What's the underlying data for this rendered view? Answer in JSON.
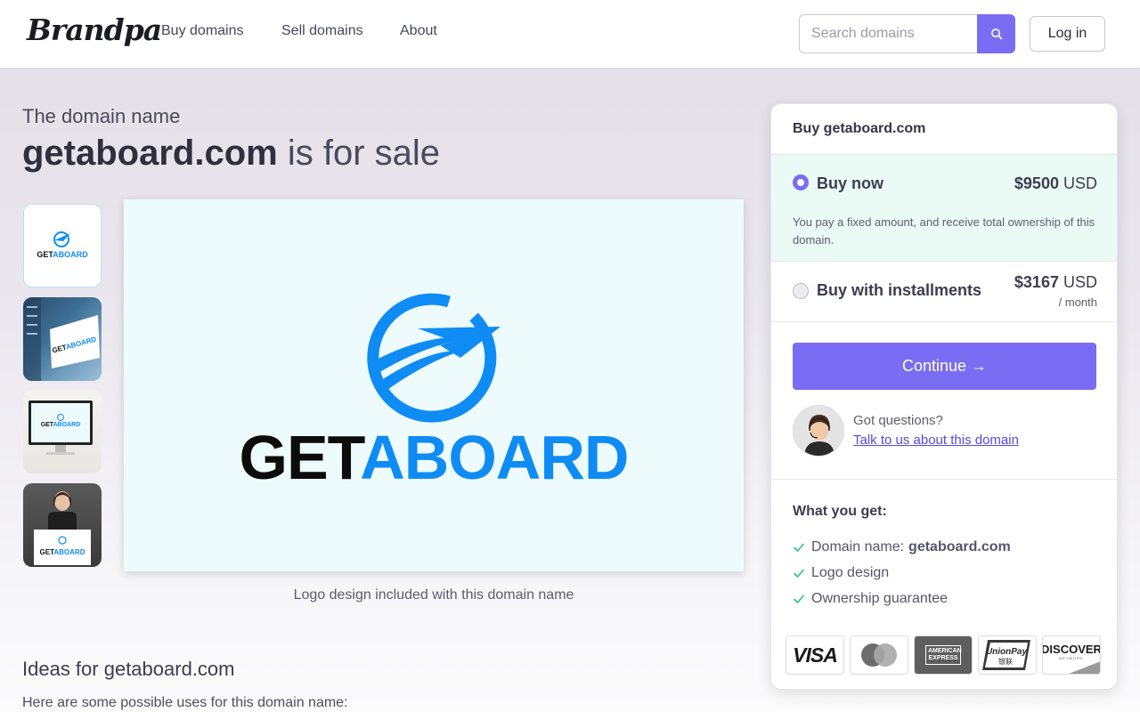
{
  "header": {
    "logo": "Brandpa",
    "nav": [
      {
        "label": "Buy domains"
      },
      {
        "label": "Sell domains"
      },
      {
        "label": "About"
      }
    ],
    "search_placeholder": "Search domains",
    "login_label": "Log in"
  },
  "hero": {
    "subtitle": "The domain name",
    "domain": "getaboard.com",
    "for_sale": "is for sale"
  },
  "logo_image": {
    "text_black": "GET",
    "text_blue": "ABOARD",
    "caption": "Logo design included with this domain name",
    "colors": {
      "blue": "#0f8cf3",
      "black": "#0c0c0c",
      "background": "#eefbfd"
    }
  },
  "thumbnails": [
    "logo-thumbnail",
    "building-sign-thumbnail",
    "computer-screen-thumbnail",
    "person-holding-sign-thumbnail"
  ],
  "ideas": {
    "title": "Ideas for getaboard.com",
    "text": "Here are some possible uses for this domain name:"
  },
  "card": {
    "title": "Buy getaboard.com",
    "buy_now": {
      "label": "Buy now",
      "price": "$9500",
      "currency": "USD",
      "description": "You pay a fixed amount, and receive total ownership of this domain.",
      "selected": true
    },
    "installments": {
      "label": "Buy with installments",
      "price": "$3167",
      "currency": "USD",
      "period": "/ month",
      "selected": false
    },
    "continue_label": "Continue →",
    "questions": "Got questions?",
    "talk_link": "Talk to us about this domain",
    "what_you_get": {
      "title": "What you get:",
      "items": [
        {
          "label": "Domain name:",
          "value": "getaboard.com"
        },
        {
          "label": "Logo design",
          "value": ""
        },
        {
          "label": "Ownership guarantee",
          "value": ""
        }
      ]
    },
    "payment_methods": [
      "VISA",
      "mastercard",
      "AMERICAN EXPRESS",
      "UnionPay",
      "DISCOVER"
    ],
    "accent_color": "#7a6cf3"
  }
}
